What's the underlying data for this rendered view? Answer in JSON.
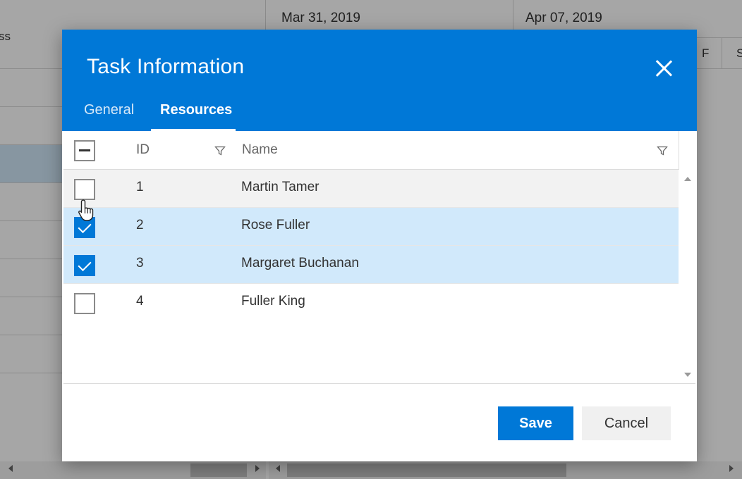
{
  "background": {
    "left_header_label": "ss",
    "dates": [
      "Mar 31, 2019",
      "Apr 07, 2019"
    ],
    "days": [
      "F",
      "S"
    ]
  },
  "dialog": {
    "title": "Task Information",
    "tabs": [
      {
        "label": "General",
        "active": false
      },
      {
        "label": "Resources",
        "active": true
      }
    ],
    "grid": {
      "columns": [
        "ID",
        "Name"
      ],
      "rows": [
        {
          "id": "1",
          "name": "Martin Tamer",
          "checked": false
        },
        {
          "id": "2",
          "name": "Rose Fuller",
          "checked": true
        },
        {
          "id": "3",
          "name": "Margaret Buchanan",
          "checked": true
        },
        {
          "id": "4",
          "name": "Fuller King",
          "checked": false
        }
      ]
    },
    "buttons": {
      "save": "Save",
      "cancel": "Cancel"
    }
  },
  "colors": {
    "accent": "#0078d7",
    "selected_row": "#d1e9fb"
  }
}
